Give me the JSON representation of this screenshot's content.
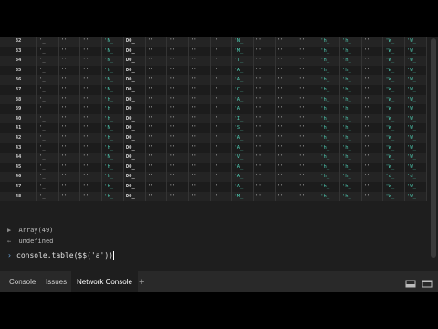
{
  "table": {
    "rows": [
      {
        "index": "32",
        "cells": [
          "'_",
          "''",
          "''",
          "'N_",
          "DO_",
          "''",
          "''",
          "''",
          "''",
          "'N_",
          "''",
          "''",
          "''",
          "'h_",
          "'h_",
          "''",
          "'W_",
          "'W_"
        ]
      },
      {
        "index": "33",
        "cells": [
          "'_",
          "''",
          "''",
          "'N_",
          "DO_",
          "''",
          "''",
          "''",
          "''",
          "'M_",
          "''",
          "''",
          "''",
          "'h_",
          "'h_",
          "''",
          "'W_",
          "'W_"
        ]
      },
      {
        "index": "34",
        "cells": [
          "'_",
          "''",
          "''",
          "'N_",
          "DO_",
          "''",
          "''",
          "''",
          "''",
          "'T_",
          "''",
          "''",
          "''",
          "'h_",
          "'h_",
          "''",
          "'W_",
          "'W_"
        ]
      },
      {
        "index": "35",
        "cells": [
          "'_",
          "''",
          "''",
          "'h_",
          "DO_",
          "''",
          "''",
          "''",
          "''",
          "'A_",
          "''",
          "''",
          "''",
          "'h_",
          "'h_",
          "''",
          "'W_",
          "'W_"
        ]
      },
      {
        "index": "36",
        "cells": [
          "'_",
          "''",
          "''",
          "'N_",
          "DO_",
          "''",
          "''",
          "''",
          "''",
          "'A_",
          "''",
          "''",
          "''",
          "'h_",
          "'h_",
          "''",
          "'W_",
          "'W_"
        ]
      },
      {
        "index": "37",
        "cells": [
          "'_",
          "''",
          "''",
          "'N_",
          "DO_",
          "''",
          "''",
          "''",
          "''",
          "'C_",
          "''",
          "''",
          "''",
          "'h_",
          "'h_",
          "''",
          "'W_",
          "'W_"
        ]
      },
      {
        "index": "38",
        "cells": [
          "'_",
          "''",
          "''",
          "'h_",
          "DO_",
          "''",
          "''",
          "''",
          "''",
          "'A_",
          "''",
          "''",
          "''",
          "'h_",
          "'h_",
          "''",
          "'W_",
          "'W_"
        ]
      },
      {
        "index": "39",
        "cells": [
          "'_",
          "''",
          "''",
          "'h_",
          "DO_",
          "''",
          "''",
          "''",
          "''",
          "'A_",
          "''",
          "''",
          "''",
          "'h_",
          "'h_",
          "''",
          "'W_",
          "'W_"
        ]
      },
      {
        "index": "40",
        "cells": [
          "'_",
          "''",
          "''",
          "'h_",
          "DO_",
          "''",
          "''",
          "''",
          "''",
          "'I_",
          "''",
          "''",
          "''",
          "'h_",
          "'h_",
          "''",
          "'W_",
          "'W_"
        ]
      },
      {
        "index": "41",
        "cells": [
          "'_",
          "''",
          "''",
          "'N_",
          "DO_",
          "''",
          "''",
          "''",
          "''",
          "'S_",
          "''",
          "''",
          "''",
          "'h_",
          "'h_",
          "''",
          "'W_",
          "'W_"
        ]
      },
      {
        "index": "42",
        "cells": [
          "'_",
          "''",
          "''",
          "'h_",
          "DO_",
          "''",
          "''",
          "''",
          "''",
          "'A_",
          "''",
          "''",
          "''",
          "'h_",
          "'h_",
          "''",
          "'W_",
          "'W_"
        ]
      },
      {
        "index": "43",
        "cells": [
          "'_",
          "''",
          "''",
          "'h_",
          "DO_",
          "''",
          "''",
          "''",
          "''",
          "'A_",
          "''",
          "''",
          "''",
          "'h_",
          "'h_",
          "''",
          "'W_",
          "'W_"
        ]
      },
      {
        "index": "44",
        "cells": [
          "'_",
          "''",
          "''",
          "'N_",
          "DO_",
          "''",
          "''",
          "''",
          "''",
          "'V_",
          "''",
          "''",
          "''",
          "'h_",
          "'h_",
          "''",
          "'W_",
          "'W_"
        ]
      },
      {
        "index": "45",
        "cells": [
          "'_",
          "''",
          "''",
          "'h_",
          "DO_",
          "''",
          "''",
          "''",
          "''",
          "'A_",
          "''",
          "''",
          "''",
          "'h_",
          "'h_",
          "''",
          "'W_",
          "'W_"
        ]
      },
      {
        "index": "46",
        "cells": [
          "'_",
          "''",
          "''",
          "'h_",
          "DO_",
          "''",
          "''",
          "''",
          "''",
          "'A_",
          "''",
          "''",
          "''",
          "'h_",
          "'h_",
          "''",
          "'d_",
          "'d_"
        ]
      },
      {
        "index": "47",
        "cells": [
          "'_",
          "''",
          "''",
          "'h_",
          "DO_",
          "''",
          "''",
          "''",
          "''",
          "'A_",
          "''",
          "''",
          "''",
          "'h_",
          "'h_",
          "''",
          "'W_",
          "'W_"
        ]
      },
      {
        "index": "48",
        "cells": [
          "'_",
          "''",
          "''",
          "'h_",
          "DO_",
          "''",
          "''",
          "''",
          "''",
          "'M_",
          "''",
          "''",
          "''",
          "'h_",
          "'h_",
          "''",
          "'W_",
          "'W_"
        ]
      }
    ]
  },
  "console": {
    "array_label": "Array(49)",
    "undefined_label": "undefined",
    "prompt_input": "console.table($$('a'))"
  },
  "tabs": [
    {
      "label": "Console",
      "active": false
    },
    {
      "label": "Issues",
      "active": false
    },
    {
      "label": "Network Console",
      "active": true
    }
  ],
  "icons": {
    "add_tab": "plus-icon",
    "dock": "dock-icon",
    "undock": "undock-icon"
  },
  "colors": {
    "background": "#1e1e1e",
    "string_green": "#4ec9b0",
    "tabbar": "#292929"
  }
}
